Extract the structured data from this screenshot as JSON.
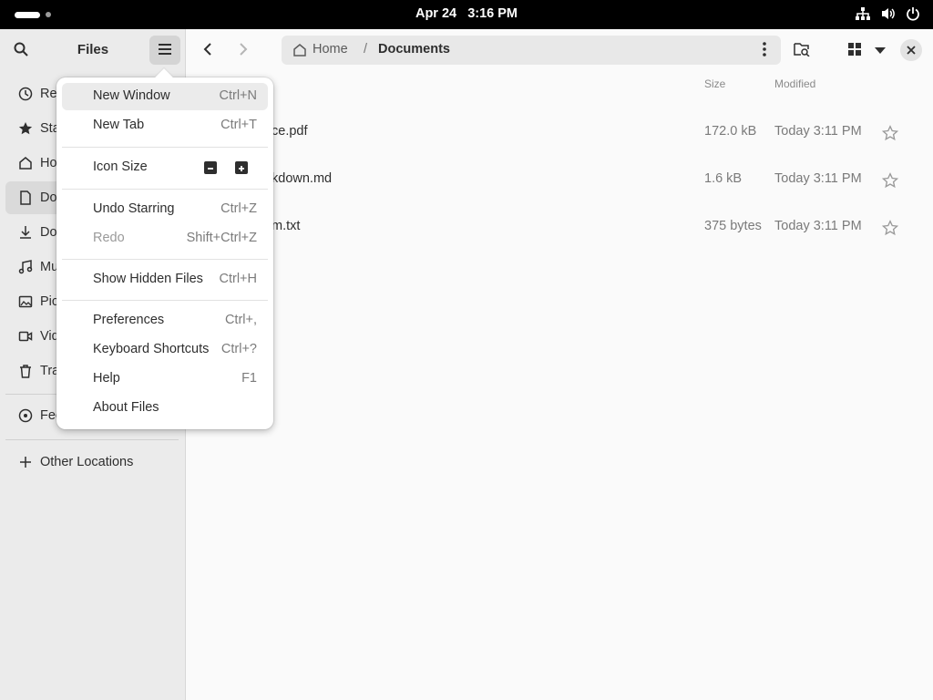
{
  "topbar": {
    "date": "Apr 24",
    "time": "3:16 PM"
  },
  "sidebar": {
    "title": "Files",
    "items": [
      {
        "label": "Recent",
        "icon": "clock-icon"
      },
      {
        "label": "Starred",
        "icon": "star-icon"
      },
      {
        "label": "Home",
        "icon": "home-icon"
      },
      {
        "label": "Documents",
        "icon": "document-icon"
      },
      {
        "label": "Downloads",
        "icon": "download-icon"
      },
      {
        "label": "Music",
        "icon": "music-icon"
      },
      {
        "label": "Pictures",
        "icon": "picture-icon"
      },
      {
        "label": "Videos",
        "icon": "video-icon"
      },
      {
        "label": "Trash",
        "icon": "trash-icon"
      },
      {
        "label": "Feeds",
        "icon": "disc-icon"
      }
    ],
    "other_locations": "Other Locations"
  },
  "pathbar": {
    "home": "Home",
    "separator": "/",
    "current": "Documents"
  },
  "columns": {
    "size": "Size",
    "modified": "Modified"
  },
  "files": [
    {
      "name": "ce.pdf",
      "size": "172.0 kB",
      "modified": "Today 3:11 PM"
    },
    {
      "name": "kdown.md",
      "size": "1.6 kB",
      "modified": "Today 3:11 PM"
    },
    {
      "name": "m.txt",
      "size": "375 bytes",
      "modified": "Today 3:11 PM"
    }
  ],
  "menu": {
    "new_window": {
      "label": "New Window",
      "accel": "Ctrl+N"
    },
    "new_tab": {
      "label": "New Tab",
      "accel": "Ctrl+T"
    },
    "icon_size": {
      "label": "Icon Size"
    },
    "undo": {
      "label": "Undo Starring",
      "accel": "Ctrl+Z"
    },
    "redo": {
      "label": "Redo",
      "accel": "Shift+Ctrl+Z"
    },
    "hidden": {
      "label": "Show Hidden Files",
      "accel": "Ctrl+H"
    },
    "preferences": {
      "label": "Preferences",
      "accel": "Ctrl+,"
    },
    "shortcuts": {
      "label": "Keyboard Shortcuts",
      "accel": "Ctrl+?"
    },
    "help": {
      "label": "Help",
      "accel": "F1"
    },
    "about": {
      "label": "About Files"
    }
  }
}
